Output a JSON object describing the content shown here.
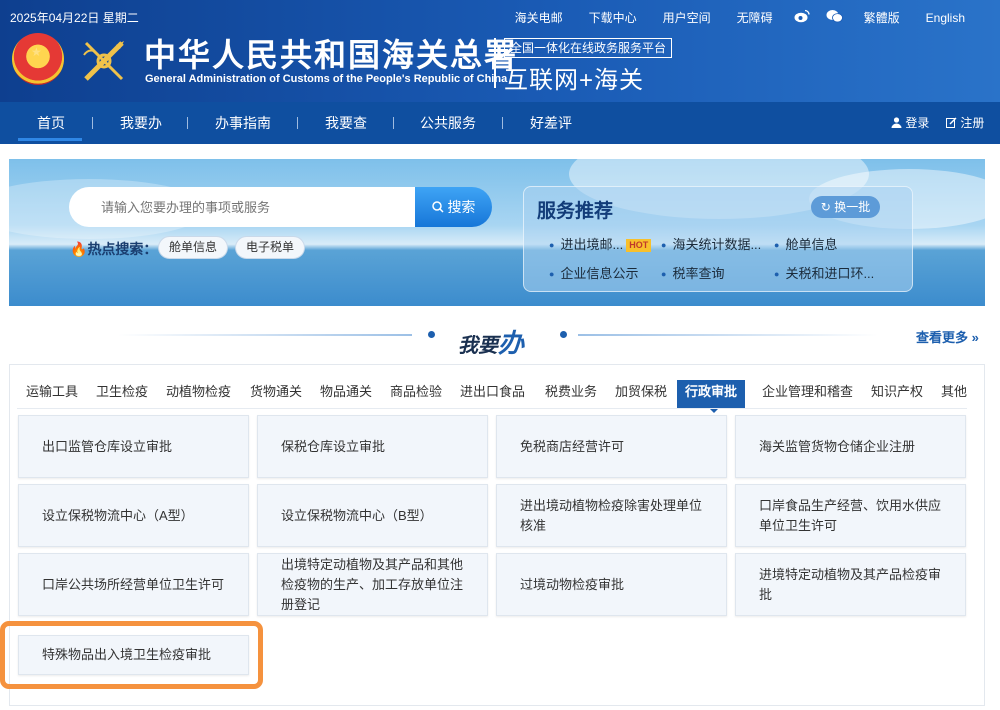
{
  "header": {
    "date": "2025年04月22日 星期二",
    "top_links": [
      "海关电邮",
      "下载中心",
      "用户空间",
      "无障碍"
    ],
    "top_links_right": [
      "繁體版",
      "English"
    ],
    "title_cn": "中华人民共和国海关总署",
    "title_en": "General Administration of Customs of the People's Republic of China",
    "platform_box": "全国一体化在线政务服务平台",
    "platform_big": "互联网+海关"
  },
  "nav": {
    "items": [
      "首页",
      "我要办",
      "办事指南",
      "我要查",
      "公共服务",
      "好差评"
    ],
    "login": "登录",
    "register": "注册"
  },
  "search": {
    "placeholder": "请输入您要办理的事项或服务",
    "button": "搜索",
    "hot_label": "热点搜索：",
    "hot_tags": [
      "舱单信息",
      "电子税单"
    ]
  },
  "services": {
    "title": "服务推荐",
    "swap": "换一批",
    "items": [
      "进出境邮...",
      "海关统计数据...",
      "舱单信息",
      "企业信息公示",
      "税率查询",
      "关税和进口环..."
    ],
    "hot_badge": "HOT"
  },
  "section": {
    "title_small": "我要",
    "title_big": "办",
    "see_more": "查看更多 »"
  },
  "tabs": [
    "运输工具",
    "卫生检疫",
    "动植物检疫",
    "货物通关",
    "物品通关",
    "商品检验",
    "进出口食品",
    "税费业务",
    "加贸保税",
    "行政审批",
    "企业管理和稽查",
    "知识产权",
    "其他"
  ],
  "cards": [
    "出口监管仓库设立审批",
    "保税仓库设立审批",
    "免税商店经营许可",
    "海关监管货物仓储企业注册",
    "设立保税物流中心（A型）",
    "设立保税物流中心（B型）",
    "进出境动植物检疫除害处理单位核准",
    "口岸食品生产经营、饮用水供应单位卫生许可",
    "口岸公共场所经营单位卫生许可",
    "出境特定动植物及其产品和其他检疫物的生产、加工存放单位注册登记",
    "过境动物检疫审批",
    "进境特定动植物及其产品检疫审批",
    "特殊物品出入境卫生检疫审批"
  ],
  "colors": {
    "brand": "#1d5fae",
    "header": "#0f4fa0",
    "highlight": "#f5923e",
    "hot": "#f8c02c"
  }
}
